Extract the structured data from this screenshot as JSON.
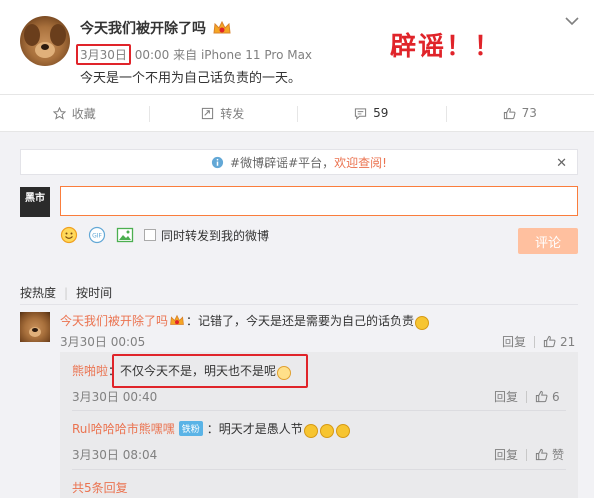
{
  "post": {
    "author": "今天我们被开除了吗",
    "date": "3月30日",
    "time": "00:00",
    "source": "来自 iPhone 11 Pro Max",
    "content": "今天是一个不用为自己话负责的一天。",
    "overlay_text": "辟谣！！"
  },
  "actions": {
    "favorite": "收藏",
    "repost": "转发",
    "comment_count": "59",
    "like_count": "73"
  },
  "panel": {
    "notice_prefix": "#微博辟谣#平台，",
    "notice_link": "欢迎查阅!",
    "notice_close": "✕",
    "logo_text": "黑市",
    "input_value": "",
    "forward_label": "同时转发到我的微博",
    "submit_label": "评论",
    "sort_hot": "按热度",
    "sort_time": "按时间",
    "tool_icons": [
      "emoji-icon",
      "gif-icon",
      "image-icon"
    ]
  },
  "comment": {
    "name": "今天我们被开除了吗",
    "text": "：记错了，今天是还是需要为自己的话负责",
    "date": "3月30日 00:05",
    "reply_label": "回复",
    "like_count": "21"
  },
  "replies": [
    {
      "name": "熊啪啦",
      "text": "：不仅今天不是，明天也不是呢",
      "date": "3月30日 00:40",
      "reply_label": "回复",
      "like_count": "6"
    },
    {
      "name": "Rul哈哈哈市熊嘿嘿",
      "badge": "铁粉",
      "text": "：明天才是愚人节",
      "date": "3月30日 08:04",
      "reply_label": "回复",
      "like_count": "赞"
    }
  ],
  "more_replies": "共5条回复",
  "colors": {
    "accent": "#eb7350",
    "highlight_red": "#e0242a",
    "panel_bg": "#f2f2f5",
    "submit_bg": "#ffc09f"
  }
}
